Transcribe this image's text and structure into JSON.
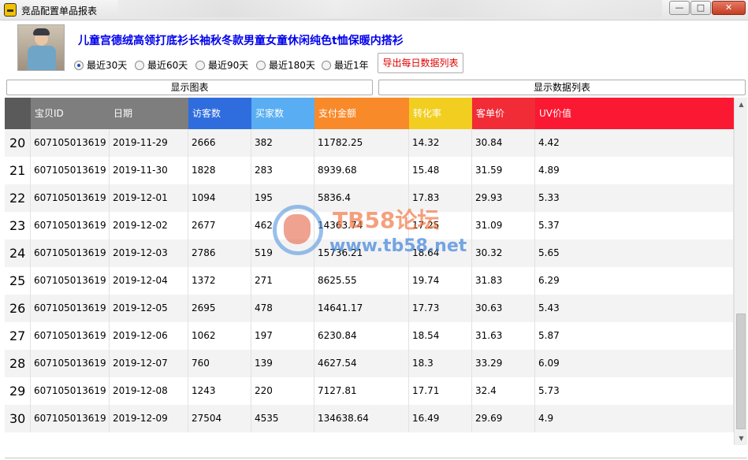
{
  "window": {
    "title": "竞品配置单品报表",
    "minimize_icon": "minimize-icon",
    "maximize_icon": "maximize-icon",
    "close_icon": "close-icon"
  },
  "product": {
    "title": "儿童宫德绒高领打底衫长袖秋冬款男童女童休闲纯色t恤保暖内搭衫",
    "title_color": "#0000ee"
  },
  "range_options": [
    {
      "label": "最近30天",
      "selected": true
    },
    {
      "label": "最近60天",
      "selected": false
    },
    {
      "label": "最近90天",
      "selected": false
    },
    {
      "label": "最近180天",
      "selected": false
    },
    {
      "label": "最近1年",
      "selected": false
    }
  ],
  "buttons": {
    "export": "导出每日数据列表",
    "show_chart": "显示图表",
    "show_list": "显示数据列表"
  },
  "table": {
    "columns": [
      {
        "label": "",
        "color": "#5a5a5a"
      },
      {
        "label": "宝贝ID",
        "color": "#7e7e7e"
      },
      {
        "label": "日期",
        "color": "#7e7e7e"
      },
      {
        "label": "访客数",
        "color": "#2f6ddf"
      },
      {
        "label": "买家数",
        "color": "#59aef3"
      },
      {
        "label": "支付金额",
        "color": "#f98a2a"
      },
      {
        "label": "转化率",
        "color": "#f2ce20"
      },
      {
        "label": "客单价",
        "color": "#f12c36"
      },
      {
        "label": "UV价值",
        "color": "#fb1832"
      }
    ],
    "rows": [
      [
        "20",
        "607105013619",
        "2019-11-29",
        "2666",
        "382",
        "11782.25",
        "14.32",
        "30.84",
        "4.42"
      ],
      [
        "21",
        "607105013619",
        "2019-11-30",
        "1828",
        "283",
        "8939.68",
        "15.48",
        "31.59",
        "4.89"
      ],
      [
        "22",
        "607105013619",
        "2019-12-01",
        "1094",
        "195",
        "5836.4",
        "17.83",
        "29.93",
        "5.33"
      ],
      [
        "23",
        "607105013619",
        "2019-12-02",
        "2677",
        "462",
        "14363.74",
        "17.25",
        "31.09",
        "5.37"
      ],
      [
        "24",
        "607105013619",
        "2019-12-03",
        "2786",
        "519",
        "15736.21",
        "18.64",
        "30.32",
        "5.65"
      ],
      [
        "25",
        "607105013619",
        "2019-12-04",
        "1372",
        "271",
        "8625.55",
        "19.74",
        "31.83",
        "6.29"
      ],
      [
        "26",
        "607105013619",
        "2019-12-05",
        "2695",
        "478",
        "14641.17",
        "17.73",
        "30.63",
        "5.43"
      ],
      [
        "27",
        "607105013619",
        "2019-12-06",
        "1062",
        "197",
        "6230.84",
        "18.54",
        "31.63",
        "5.87"
      ],
      [
        "28",
        "607105013619",
        "2019-12-07",
        "760",
        "139",
        "4627.54",
        "18.3",
        "33.29",
        "6.09"
      ],
      [
        "29",
        "607105013619",
        "2019-12-08",
        "1243",
        "220",
        "7127.81",
        "17.71",
        "32.4",
        "5.73"
      ],
      [
        "30",
        "607105013619",
        "2019-12-09",
        "27504",
        "4535",
        "134638.64",
        "16.49",
        "29.69",
        "4.9"
      ]
    ]
  },
  "watermark": {
    "line1": "TB58论坛",
    "line2": "www.tb58.net"
  }
}
